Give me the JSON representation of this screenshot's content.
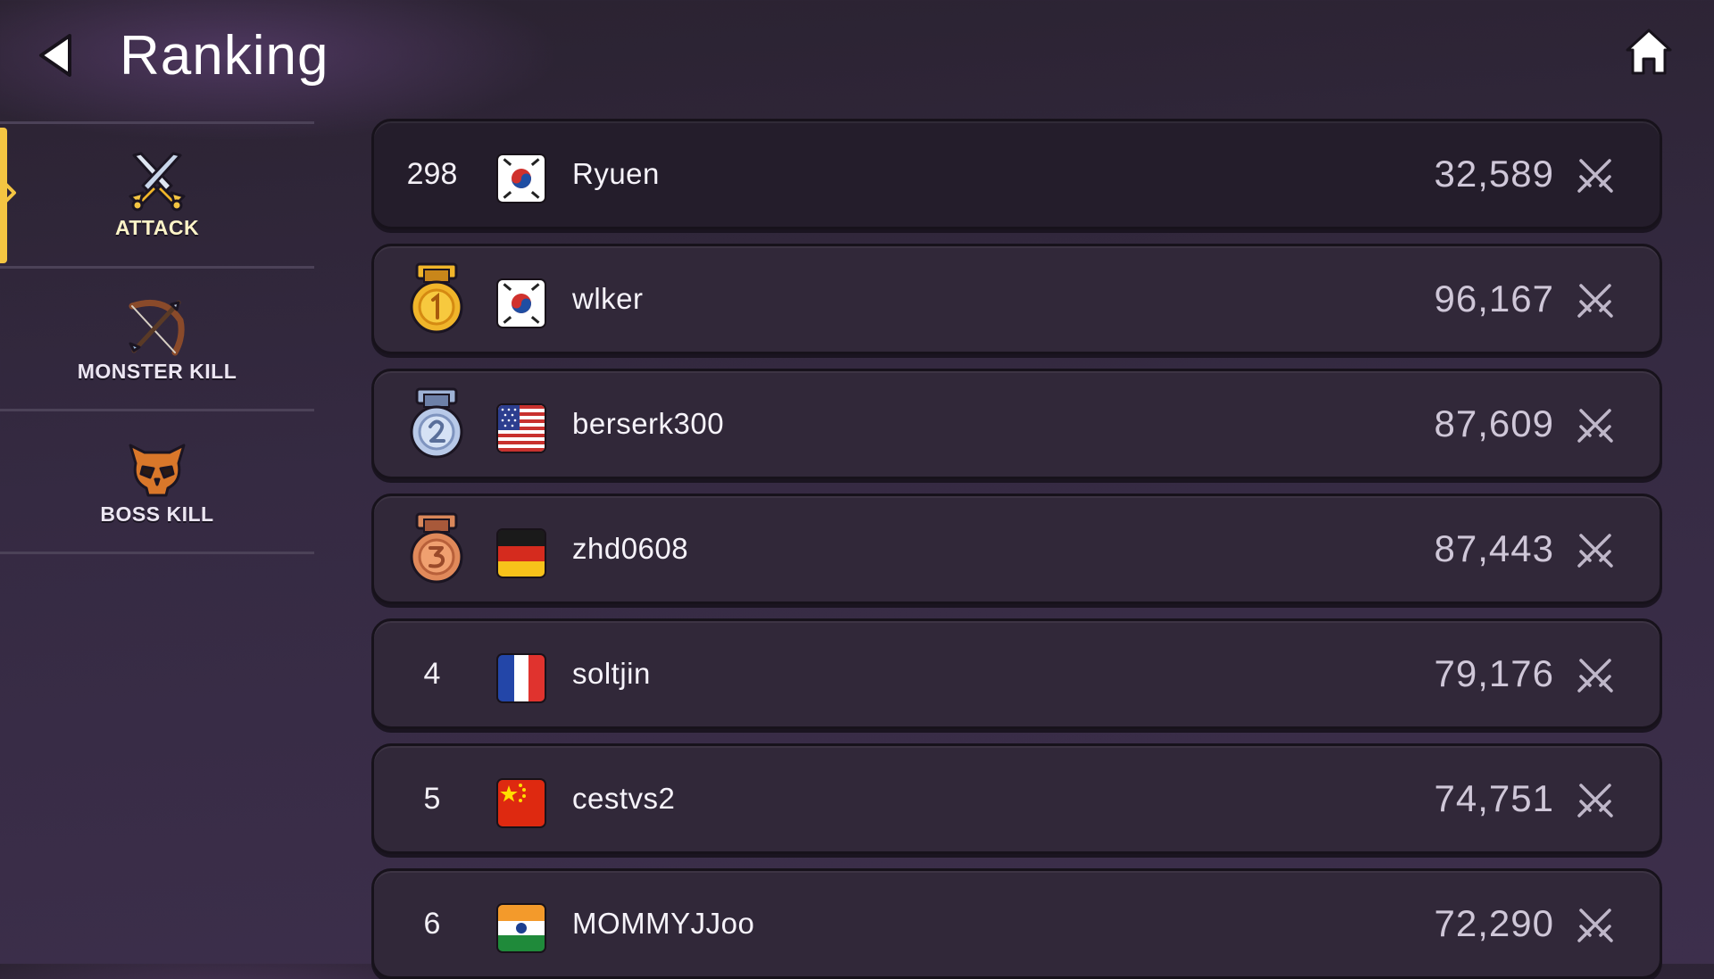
{
  "header": {
    "title": "Ranking"
  },
  "sidebar": {
    "tabs": [
      {
        "label": "ATTACK",
        "icon": "crossed-swords-icon",
        "active": true
      },
      {
        "label": "MONSTER KILL",
        "icon": "bow-arrow-icon",
        "active": false
      },
      {
        "label": "BOSS KILL",
        "icon": "skull-icon",
        "active": false
      }
    ]
  },
  "colors": {
    "active_marker": "#f4c542",
    "row_bg": "#312839",
    "my_row_bg": "#241d2b",
    "score_text": "#cfc7d8"
  },
  "my_rank": {
    "rank": "298",
    "country": "South Korea",
    "flag": "kr-flag-icon",
    "name": "Ryuen",
    "score": "32,589"
  },
  "rankings": [
    {
      "rank": "1",
      "medal": "gold-medal-icon",
      "country": "South Korea",
      "flag": "kr-flag-icon",
      "name": "wlker",
      "score": "96,167"
    },
    {
      "rank": "2",
      "medal": "silver-medal-icon",
      "country": "United States",
      "flag": "us-flag-icon",
      "name": "berserk300",
      "score": "87,609"
    },
    {
      "rank": "3",
      "medal": "bronze-medal-icon",
      "country": "Germany",
      "flag": "de-flag-icon",
      "name": "zhd0608",
      "score": "87,443"
    },
    {
      "rank": "4",
      "medal": null,
      "country": "France",
      "flag": "fr-flag-icon",
      "name": "soltjin",
      "score": "79,176"
    },
    {
      "rank": "5",
      "medal": null,
      "country": "China",
      "flag": "cn-flag-icon",
      "name": "cestvs2",
      "score": "74,751"
    },
    {
      "rank": "6",
      "medal": null,
      "country": "India",
      "flag": "in-flag-icon",
      "name": "MOMMYJJoo",
      "score": "72,290"
    }
  ]
}
